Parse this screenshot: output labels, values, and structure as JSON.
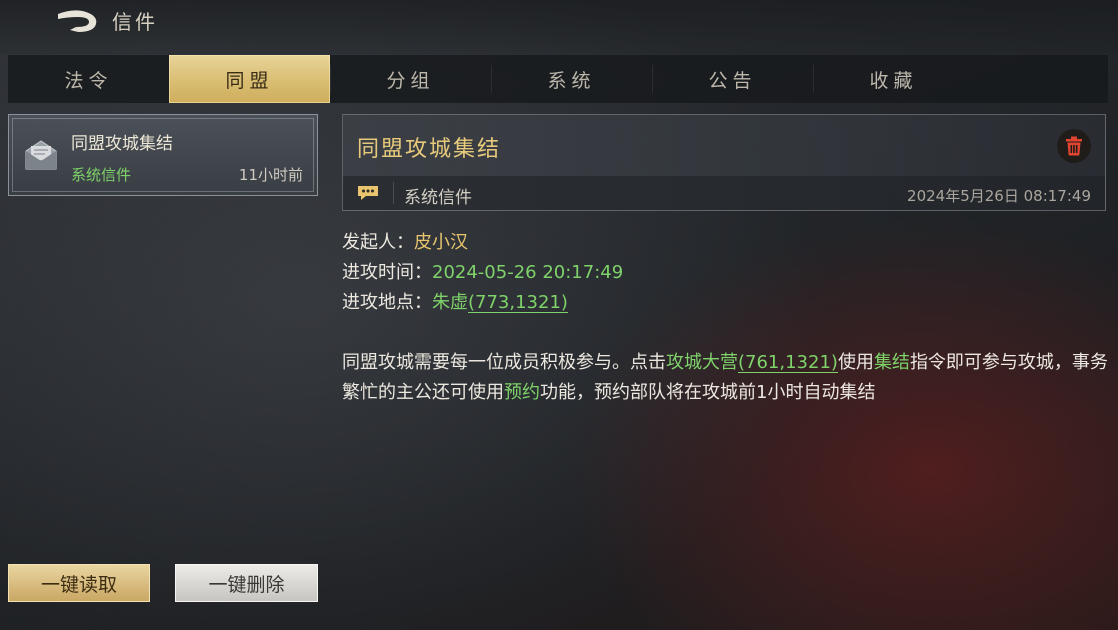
{
  "header": {
    "title": "信件"
  },
  "tabs": [
    {
      "label": "法令"
    },
    {
      "label": "同盟"
    },
    {
      "label": "分组"
    },
    {
      "label": "系统"
    },
    {
      "label": "公告"
    },
    {
      "label": "收藏"
    }
  ],
  "active_tab": "同盟",
  "mail_list": [
    {
      "title": "同盟攻城集结",
      "type": "系统信件",
      "time": "11小时前",
      "icon": "mail-envelope-icon"
    }
  ],
  "actions": {
    "read_all": "一键读取",
    "delete_all": "一键删除"
  },
  "detail": {
    "title": "同盟攻城集结",
    "type": "系统信件",
    "datetime": "2024年5月26日 08:17:49",
    "initiator_label": "发起人：",
    "initiator": "皮小汉",
    "attack_time_label": "进攻时间：",
    "attack_time": "2024-05-26 20:17:49",
    "attack_place_label": "进攻地点：",
    "attack_place_name": "朱虚",
    "attack_place_coords": "(773,1321)",
    "body": {
      "p1": "同盟攻城需要每一位成员积极参与。点击",
      "link1": "攻城大营",
      "link1_coords": "(761,1321)",
      "p2": "使用",
      "hl1": "集结",
      "p3": "指令即可参与攻城，事务繁忙的主公还可使用",
      "hl2": "预约",
      "p4": "功能，预约部队将在攻城前1小时自动集结"
    }
  },
  "colors": {
    "accent_gold": "#e8c56e",
    "highlight_green": "#7fd36a",
    "active_tab": "#d9bd72"
  }
}
